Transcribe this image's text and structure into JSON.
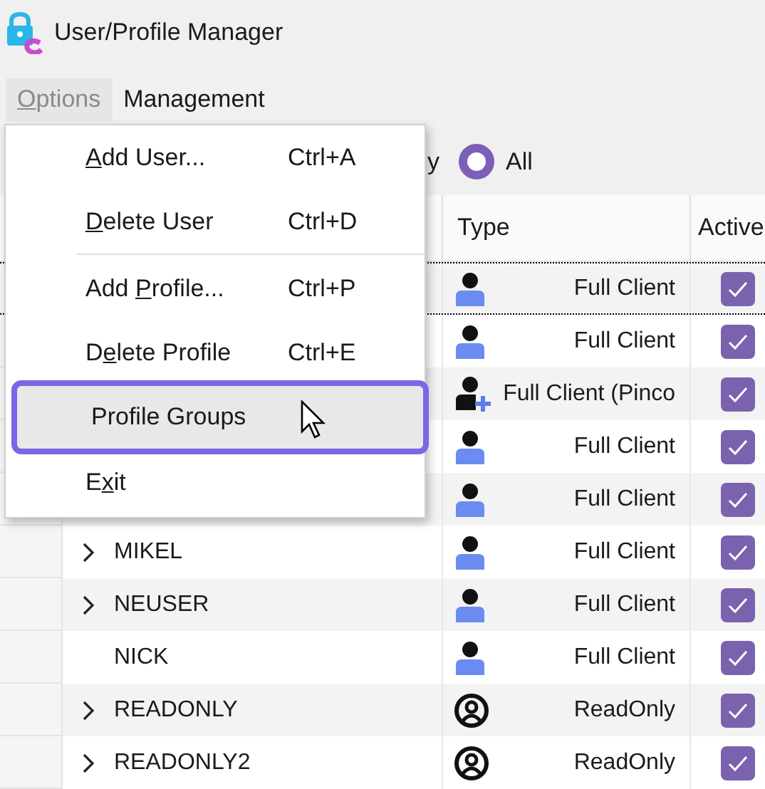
{
  "window": {
    "title": "User/Profile Manager"
  },
  "menubar": [
    {
      "key": "O",
      "post": "ptions",
      "open": true
    },
    {
      "label": "Management",
      "open": false
    }
  ],
  "filter": {
    "cut_label": "y",
    "radio": {
      "label": "All",
      "selected": true
    }
  },
  "table": {
    "columns": [
      "Type",
      "Active"
    ],
    "rows": [
      {
        "focused": true,
        "type": "Full Client",
        "kind": "user",
        "active": true
      },
      {
        "focused": false,
        "type": "Full Client",
        "kind": "user",
        "active": true
      },
      {
        "focused": false,
        "type": "Full Client (Pinco",
        "kind": "user-plus",
        "active": true
      },
      {
        "focused": false,
        "type": "Full Client",
        "kind": "user",
        "active": true
      },
      {
        "focused": false,
        "type": "Full Client",
        "kind": "user",
        "active": true
      },
      {
        "focused": false,
        "name": "MIKEL",
        "has_children": true,
        "type": "Full Client",
        "kind": "user",
        "active": true
      },
      {
        "focused": false,
        "name": "NEUSER",
        "has_children": true,
        "type": "Full Client",
        "kind": "user",
        "active": true
      },
      {
        "focused": false,
        "name": "NICK",
        "has_children": false,
        "type": "Full Client",
        "kind": "user",
        "active": true
      },
      {
        "focused": false,
        "name": "READONLY",
        "has_children": true,
        "type": "ReadOnly",
        "kind": "readonly",
        "active": true
      },
      {
        "focused": false,
        "name": "READONLY2",
        "has_children": true,
        "type": "ReadOnly",
        "kind": "readonly",
        "active": true
      }
    ]
  },
  "menu": {
    "items": [
      {
        "kind": "item",
        "key": "A",
        "post": "dd User...",
        "shortcut": "Ctrl+A",
        "selected": false
      },
      {
        "kind": "item",
        "key": "D",
        "post": "elete User",
        "shortcut": "Ctrl+D",
        "selected": false
      },
      {
        "kind": "separator"
      },
      {
        "kind": "item",
        "pre": "Add ",
        "key": "P",
        "post": "rofile...",
        "shortcut": "Ctrl+P",
        "selected": false
      },
      {
        "kind": "item",
        "pre": "D",
        "key": "e",
        "post": "lete Profile",
        "shortcut": "Ctrl+E",
        "selected": false
      },
      {
        "kind": "item",
        "pre": "Profile Groups",
        "selected": true
      },
      {
        "kind": "item",
        "pre": "E",
        "key": "x",
        "post": "it",
        "selected": false
      }
    ]
  }
}
